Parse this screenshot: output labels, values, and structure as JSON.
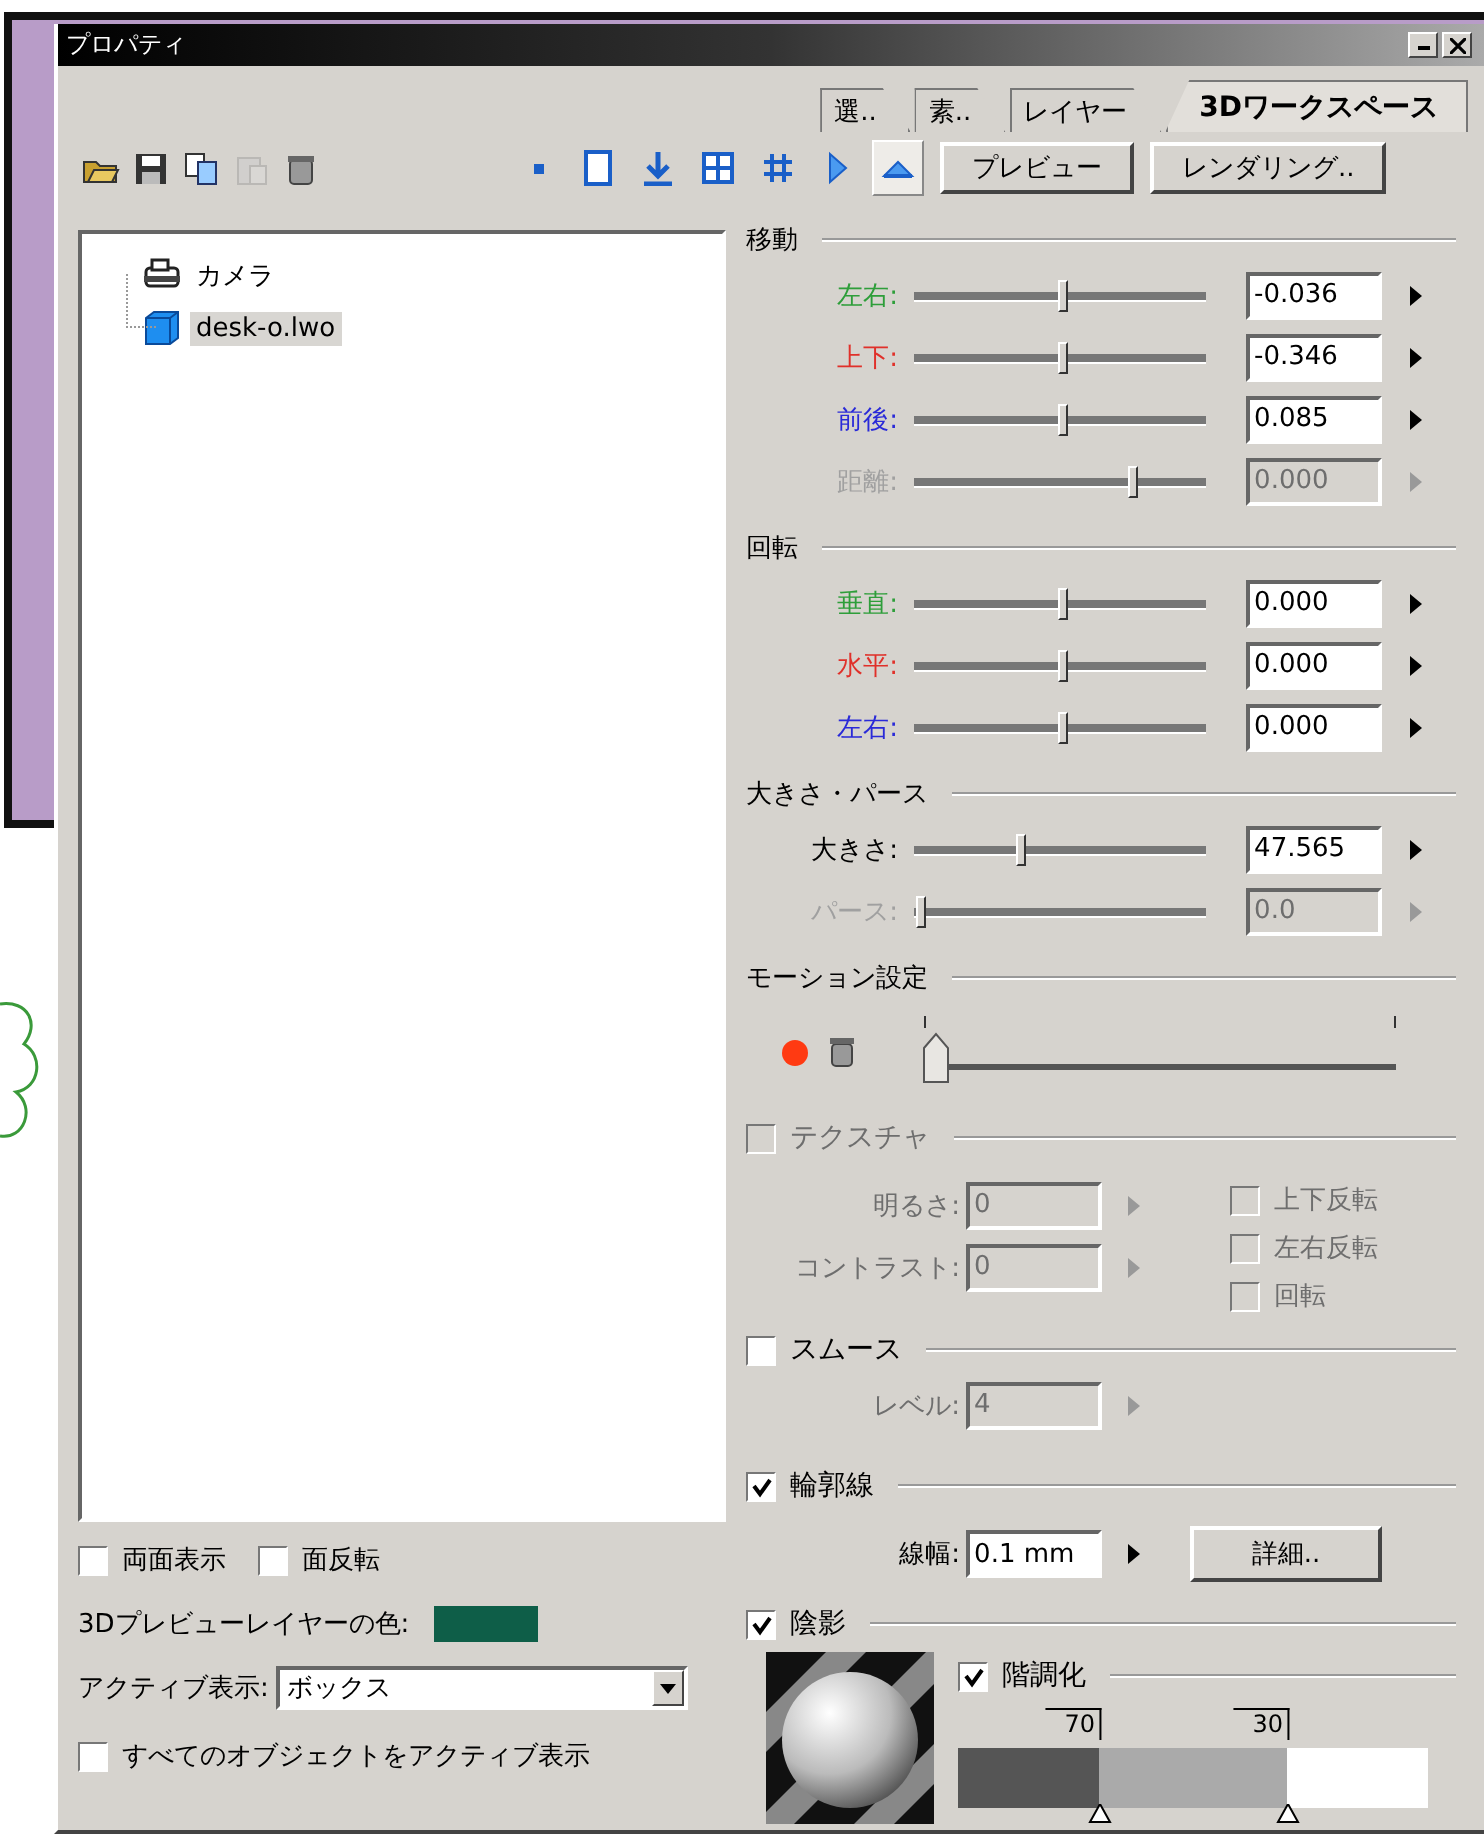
{
  "window": {
    "title": "プロパティ"
  },
  "tabs": [
    {
      "label": "選..",
      "selected": false
    },
    {
      "label": "素..",
      "selected": false
    },
    {
      "label": "レイヤー",
      "selected": false
    },
    {
      "label": "3Dワークスペース",
      "selected": true
    }
  ],
  "file_tools": [
    {
      "kind": "open",
      "disabled": false
    },
    {
      "kind": "save",
      "disabled": false
    },
    {
      "kind": "copy",
      "disabled": false
    },
    {
      "kind": "paste",
      "disabled": true
    },
    {
      "kind": "trash",
      "disabled": false
    }
  ],
  "view_modes": [
    {
      "kind": "point",
      "selected": false
    },
    {
      "kind": "frame",
      "selected": false
    },
    {
      "kind": "drop",
      "selected": false
    },
    {
      "kind": "grid",
      "selected": false
    },
    {
      "kind": "fine-grid",
      "selected": false
    },
    {
      "kind": "side",
      "selected": false
    },
    {
      "kind": "top",
      "selected": true
    }
  ],
  "buttons": [
    "プレビュー",
    "レンダリング.."
  ],
  "tree": [
    {
      "label": "カメラ",
      "kind": "camera",
      "selected": false
    },
    {
      "label": "desk-o.lwo",
      "kind": "object",
      "selected": true
    }
  ],
  "options": [
    {
      "label": "両面表示",
      "checked": false
    },
    {
      "label": "面反転",
      "checked": false
    }
  ],
  "layer_color": {
    "label": "3Dプレビューレイヤーの色:",
    "color": "#0e5e48"
  },
  "active_display": {
    "label": "アクティブ表示:",
    "value": "ボックス"
  },
  "all_active": {
    "label": "すべてのオブジェクトをアクティブ表示",
    "checked": false
  },
  "sections": [
    {
      "title": "移動",
      "rows": [
        {
          "label": "左右:",
          "color": "#2e9e3a",
          "level": 0.51,
          "value": "-0.036",
          "disabled": false
        },
        {
          "label": "上下:",
          "color": "#e0302a",
          "level": 0.51,
          "value": "-0.346",
          "disabled": false
        },
        {
          "label": "前後:",
          "color": "#2a2ad8",
          "level": 0.51,
          "value": "0.085",
          "disabled": false
        },
        {
          "label": "距離:",
          "color": "#a0a0a0",
          "level": 0.75,
          "value": "0.000",
          "disabled": true
        }
      ]
    },
    {
      "title": "回転",
      "rows": [
        {
          "label": "垂直:",
          "color": "#2e9e3a",
          "level": 0.51,
          "value": "0.000",
          "disabled": false
        },
        {
          "label": "水平:",
          "color": "#e0302a",
          "level": 0.51,
          "value": "0.000",
          "disabled": false
        },
        {
          "label": "左右:",
          "color": "#2a2ad8",
          "level": 0.51,
          "value": "0.000",
          "disabled": false
        }
      ]
    },
    {
      "title": "大きさ・パース",
      "rows": [
        {
          "label": "大きさ:",
          "color": "#000000",
          "level": 0.37,
          "value": "47.565",
          "disabled": false
        },
        {
          "label": "パース:",
          "color": "#a0a0a0",
          "level": 0.03,
          "value": "0.0",
          "disabled": true
        }
      ]
    }
  ],
  "motion": {
    "title": "モーション設定",
    "level": 0
  },
  "texture": {
    "label": "テクスチャ",
    "checked": false,
    "disabled": true,
    "fields": [
      {
        "label": "明るさ:",
        "value": "0"
      },
      {
        "label": "コントラスト:",
        "value": "0"
      }
    ],
    "flips": [
      {
        "label": "上下反転",
        "checked": false
      },
      {
        "label": "左右反転",
        "checked": false
      },
      {
        "label": "回転",
        "checked": false
      }
    ]
  },
  "smooth": {
    "label": "スムース",
    "checked": false,
    "field": {
      "label": "レベル:",
      "value": "4",
      "disabled": true
    }
  },
  "outline": {
    "label": "輪郭線",
    "checked": true,
    "field": {
      "label": "線幅:",
      "value": "0.1 mm"
    },
    "button": "詳細.."
  },
  "shading": {
    "label": "陰影",
    "checked": true,
    "posterize": {
      "label": "階調化",
      "checked": true,
      "stops": [
        {
          "label": "70",
          "level": 0.3
        },
        {
          "label": "30",
          "level": 0.7
        }
      ]
    }
  }
}
